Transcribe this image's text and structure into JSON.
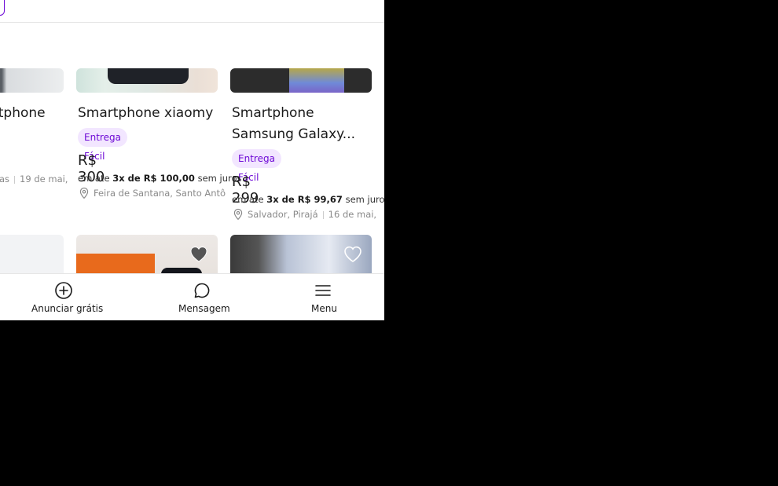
{
  "listings": [
    {
      "title_line1": "Smartphone",
      "meta_date": "19 de mai,",
      "meta_prefix": "as"
    },
    {
      "title_line1": "Smartphone xiaomy",
      "badge": "Entrega Fácil",
      "price": "R$ 300",
      "installment_prefix": "em ate",
      "installment_bold": "3x de R$ 100,00",
      "installment_suffix": "sem juros",
      "location": "Feira de Santana, Santo Antô"
    },
    {
      "title_line1": "Smartphone",
      "title_line2": "Samsung Galaxy...",
      "badge": "Entrega Fácil",
      "price": "R$ 299",
      "installment_prefix": "em ate",
      "installment_bold": "3x de R$ 99,67",
      "installment_suffix": "sem juros",
      "location": "Salvador, Pirajá",
      "date": "16 de mai,"
    }
  ],
  "bottom_nav": [
    {
      "label": "Anunciar grátis",
      "icon": "plus-circle-icon"
    },
    {
      "label": "Mensagem",
      "icon": "chat-bubble-icon"
    },
    {
      "label": "Menu",
      "icon": "hamburger-menu-icon"
    }
  ],
  "colors": {
    "brand_purple": "#6e0ad6",
    "badge_bg": "#f2e6ff",
    "background_outside": "#000000"
  }
}
